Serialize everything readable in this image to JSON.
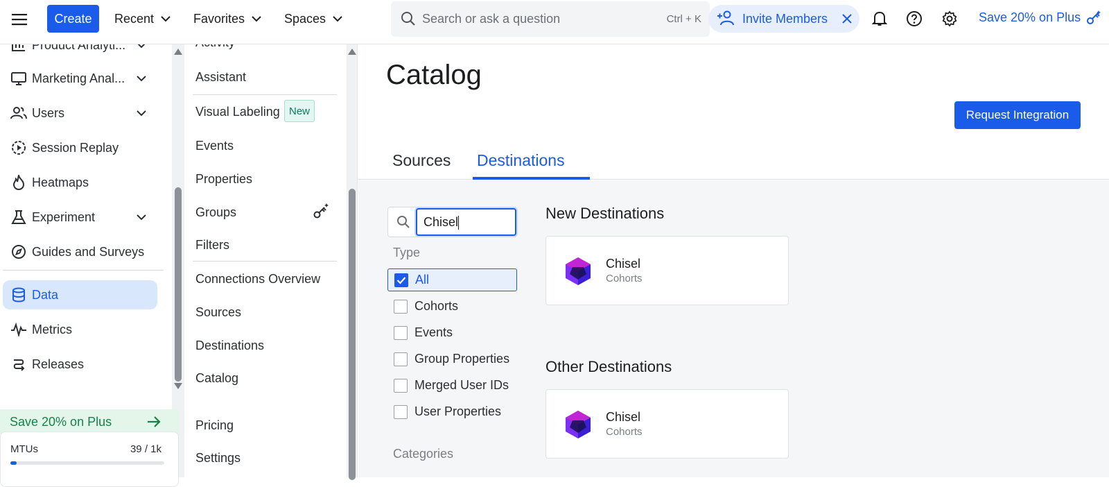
{
  "topbar": {
    "create_label": "Create",
    "nav": [
      {
        "label": "Recent"
      },
      {
        "label": "Favorites"
      },
      {
        "label": "Spaces"
      }
    ],
    "search_placeholder": "Search or ask a question",
    "search_shortcut": "Ctrl + K",
    "invite_label": "Invite Members",
    "promo_label": "Save 20% on Plus"
  },
  "sidebar": {
    "items": [
      {
        "label": "Product Analyti...",
        "icon": "bar-chart-icon",
        "has_chevron": true
      },
      {
        "label": "Marketing Anal...",
        "icon": "monitor-icon",
        "has_chevron": true
      },
      {
        "label": "Users",
        "icon": "users-icon",
        "has_chevron": true
      },
      {
        "label": "Session Replay",
        "icon": "play-circle-icon",
        "has_chevron": false
      },
      {
        "label": "Heatmaps",
        "icon": "flame-icon",
        "has_chevron": false
      },
      {
        "label": "Experiment",
        "icon": "flask-icon",
        "has_chevron": true
      },
      {
        "label": "Guides and Surveys",
        "icon": "compass-icon",
        "has_chevron": false
      },
      {
        "label": "Data",
        "icon": "database-icon",
        "has_chevron": false,
        "active": true
      },
      {
        "label": "Metrics",
        "icon": "pulse-icon",
        "has_chevron": false
      },
      {
        "label": "Releases",
        "icon": "releases-icon",
        "has_chevron": false
      }
    ],
    "save_promo": "Save 20% on Plus",
    "mtu_label": "MTUs",
    "mtu_value": "39 / 1k",
    "mtu_fraction": 0.039
  },
  "subnav": {
    "items": [
      {
        "label": "Activity"
      },
      {
        "label": "Assistant"
      },
      {
        "label": "Visual Labeling",
        "badge": "New"
      },
      {
        "label": "Events"
      },
      {
        "label": "Properties"
      },
      {
        "label": "Groups",
        "icon": "key-sparkle-icon"
      },
      {
        "label": "Filters"
      },
      {
        "label": "Connections Overview"
      },
      {
        "label": "Sources"
      },
      {
        "label": "Destinations"
      },
      {
        "label": "Catalog"
      },
      {
        "label": "Pricing"
      },
      {
        "label": "Settings"
      }
    ]
  },
  "main": {
    "title": "Catalog",
    "request_button": "Request Integration",
    "tabs": [
      {
        "label": "Sources",
        "active": false
      },
      {
        "label": "Destinations",
        "active": true
      }
    ],
    "filter": {
      "search_value": "Chisel",
      "type_label": "Type",
      "options": [
        {
          "label": "All",
          "checked": true
        },
        {
          "label": "Cohorts",
          "checked": false
        },
        {
          "label": "Events",
          "checked": false
        },
        {
          "label": "Group Properties",
          "checked": false
        },
        {
          "label": "Merged User IDs",
          "checked": false
        },
        {
          "label": "User Properties",
          "checked": false
        }
      ],
      "categories_label": "Categories"
    },
    "groups": [
      {
        "title": "New Destinations",
        "cards": [
          {
            "name": "Chisel",
            "type": "Cohorts"
          }
        ]
      },
      {
        "title": "Other Destinations",
        "cards": [
          {
            "name": "Chisel",
            "type": "Cohorts"
          }
        ]
      }
    ]
  },
  "colors": {
    "accent": "#1a5bea",
    "active_bg": "#d9e7fd",
    "promo_green": "#16824b",
    "badge_green": "#0e7a5b"
  }
}
